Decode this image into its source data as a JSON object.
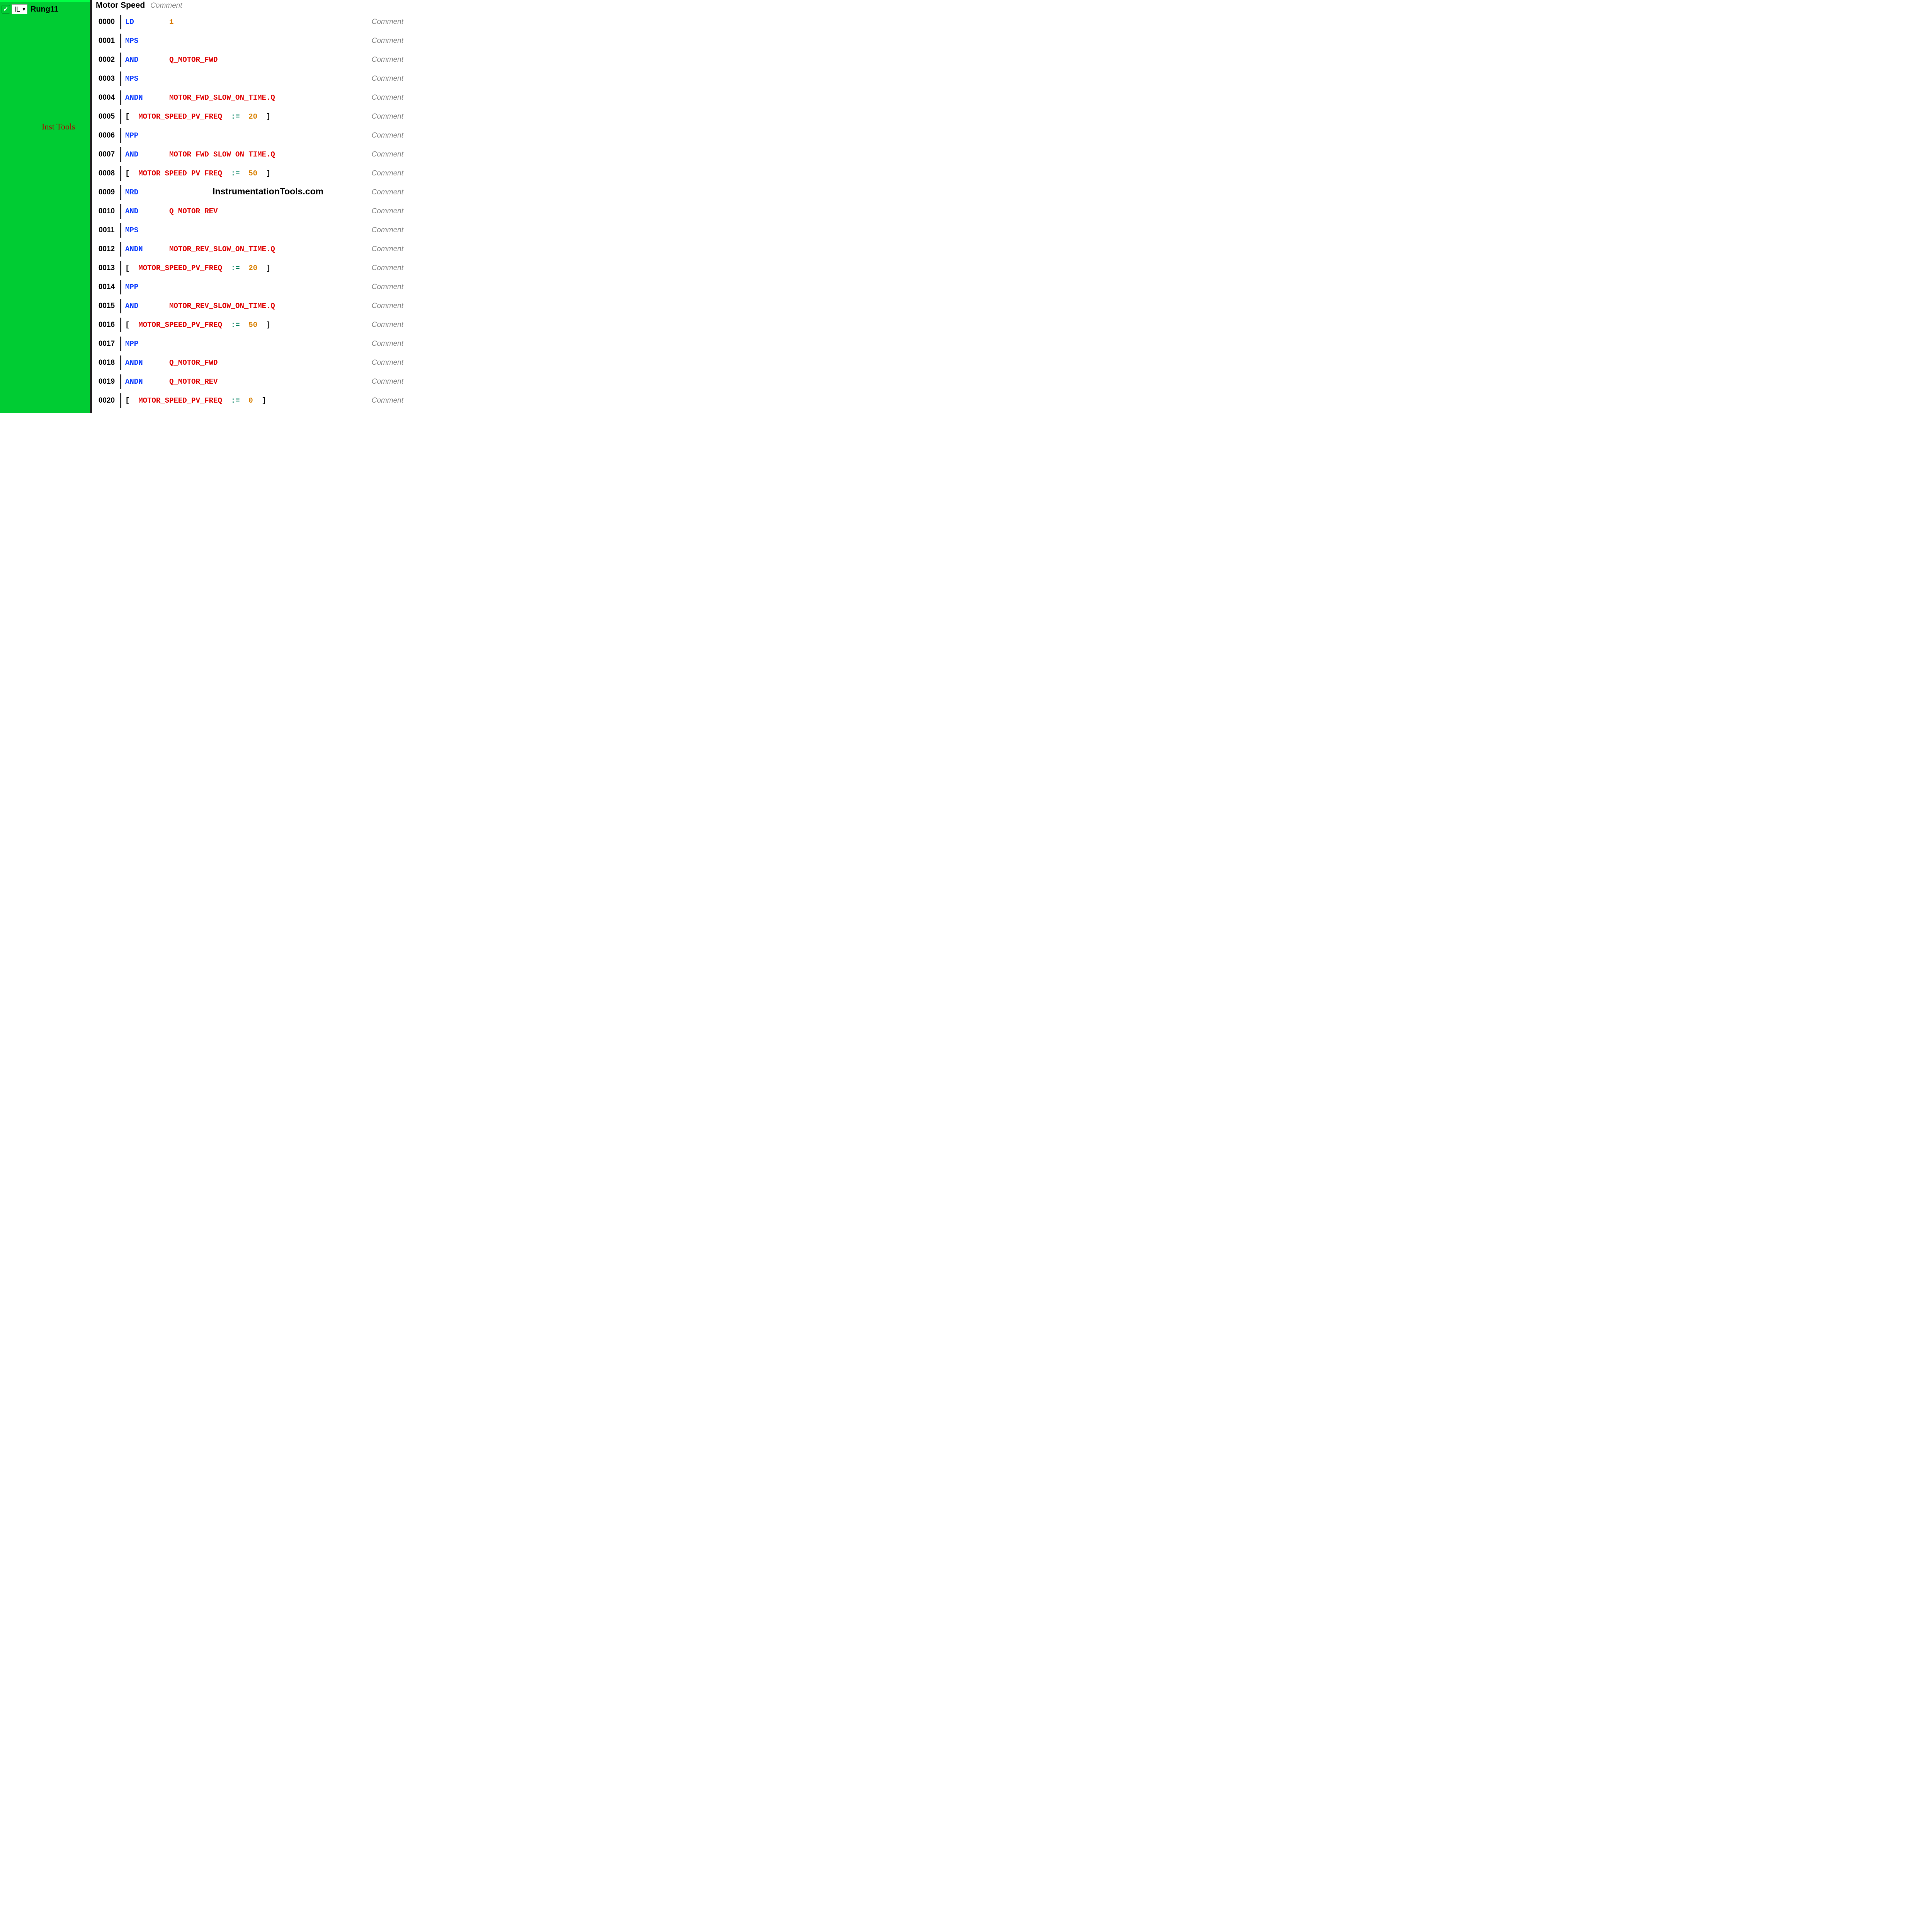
{
  "sidebar": {
    "lang": "IL",
    "rung": "Rung11",
    "watermark": "Inst Tools"
  },
  "main": {
    "title": "Motor Speed",
    "title_comment": "Comment",
    "watermark": "InstrumentationTools.com",
    "comment_label": "Comment",
    "lines": [
      {
        "num": "0000",
        "tokens": [
          {
            "t": "LD",
            "c": "blue",
            "w": 10
          },
          {
            "t": "1",
            "c": "orange"
          }
        ]
      },
      {
        "num": "0001",
        "tokens": [
          {
            "t": "MPS",
            "c": "blue"
          }
        ]
      },
      {
        "num": "0002",
        "tokens": [
          {
            "t": "AND",
            "c": "blue",
            "w": 10
          },
          {
            "t": "Q_MOTOR_FWD",
            "c": "red"
          }
        ]
      },
      {
        "num": "0003",
        "tokens": [
          {
            "t": "MPS",
            "c": "blue"
          }
        ]
      },
      {
        "num": "0004",
        "tokens": [
          {
            "t": "ANDN",
            "c": "blue",
            "w": 10
          },
          {
            "t": "MOTOR_FWD_SLOW_ON_TIME.Q",
            "c": "red"
          }
        ]
      },
      {
        "num": "0005",
        "tokens": [
          {
            "t": "[  ",
            "c": "black"
          },
          {
            "t": "MOTOR_SPEED_PV_FREQ",
            "c": "red"
          },
          {
            "t": "  :=",
            "c": "teal"
          },
          {
            "t": "  20",
            "c": "orange"
          },
          {
            "t": "  ]",
            "c": "black"
          }
        ]
      },
      {
        "num": "0006",
        "tokens": [
          {
            "t": "MPP",
            "c": "blue"
          }
        ]
      },
      {
        "num": "0007",
        "tokens": [
          {
            "t": "AND",
            "c": "blue",
            "w": 10
          },
          {
            "t": "MOTOR_FWD_SLOW_ON_TIME.Q",
            "c": "red"
          }
        ]
      },
      {
        "num": "0008",
        "tokens": [
          {
            "t": "[  ",
            "c": "black"
          },
          {
            "t": "MOTOR_SPEED_PV_FREQ",
            "c": "red"
          },
          {
            "t": "  :=",
            "c": "teal"
          },
          {
            "t": "  50",
            "c": "orange"
          },
          {
            "t": "  ]",
            "c": "black"
          }
        ]
      },
      {
        "num": "0009",
        "tokens": [
          {
            "t": "MRD",
            "c": "blue"
          }
        ]
      },
      {
        "num": "0010",
        "tokens": [
          {
            "t": "AND",
            "c": "blue",
            "w": 10
          },
          {
            "t": "Q_MOTOR_REV",
            "c": "red"
          }
        ]
      },
      {
        "num": "0011",
        "tokens": [
          {
            "t": "MPS",
            "c": "blue"
          }
        ]
      },
      {
        "num": "0012",
        "tokens": [
          {
            "t": "ANDN",
            "c": "blue",
            "w": 10
          },
          {
            "t": "MOTOR_REV_SLOW_ON_TIME.Q",
            "c": "red"
          }
        ]
      },
      {
        "num": "0013",
        "tokens": [
          {
            "t": "[  ",
            "c": "black"
          },
          {
            "t": "MOTOR_SPEED_PV_FREQ",
            "c": "red"
          },
          {
            "t": "  :=",
            "c": "teal"
          },
          {
            "t": "  20",
            "c": "orange"
          },
          {
            "t": "  ]",
            "c": "black"
          }
        ]
      },
      {
        "num": "0014",
        "tokens": [
          {
            "t": "MPP",
            "c": "blue"
          }
        ]
      },
      {
        "num": "0015",
        "tokens": [
          {
            "t": "AND",
            "c": "blue",
            "w": 10
          },
          {
            "t": "MOTOR_REV_SLOW_ON_TIME.Q",
            "c": "red"
          }
        ]
      },
      {
        "num": "0016",
        "tokens": [
          {
            "t": "[  ",
            "c": "black"
          },
          {
            "t": "MOTOR_SPEED_PV_FREQ",
            "c": "red"
          },
          {
            "t": "  :=",
            "c": "teal"
          },
          {
            "t": "  50",
            "c": "orange"
          },
          {
            "t": "  ]",
            "c": "black"
          }
        ]
      },
      {
        "num": "0017",
        "tokens": [
          {
            "t": "MPP",
            "c": "blue"
          }
        ]
      },
      {
        "num": "0018",
        "tokens": [
          {
            "t": "ANDN",
            "c": "blue",
            "w": 10
          },
          {
            "t": "Q_MOTOR_FWD",
            "c": "red"
          }
        ]
      },
      {
        "num": "0019",
        "tokens": [
          {
            "t": "ANDN",
            "c": "blue",
            "w": 10
          },
          {
            "t": "Q_MOTOR_REV",
            "c": "red"
          }
        ]
      },
      {
        "num": "0020",
        "tokens": [
          {
            "t": "[  ",
            "c": "black"
          },
          {
            "t": "MOTOR_SPEED_PV_FREQ",
            "c": "red"
          },
          {
            "t": "  :=",
            "c": "teal"
          },
          {
            "t": "  0",
            "c": "orange"
          },
          {
            "t": "  ]",
            "c": "black"
          }
        ]
      }
    ]
  }
}
